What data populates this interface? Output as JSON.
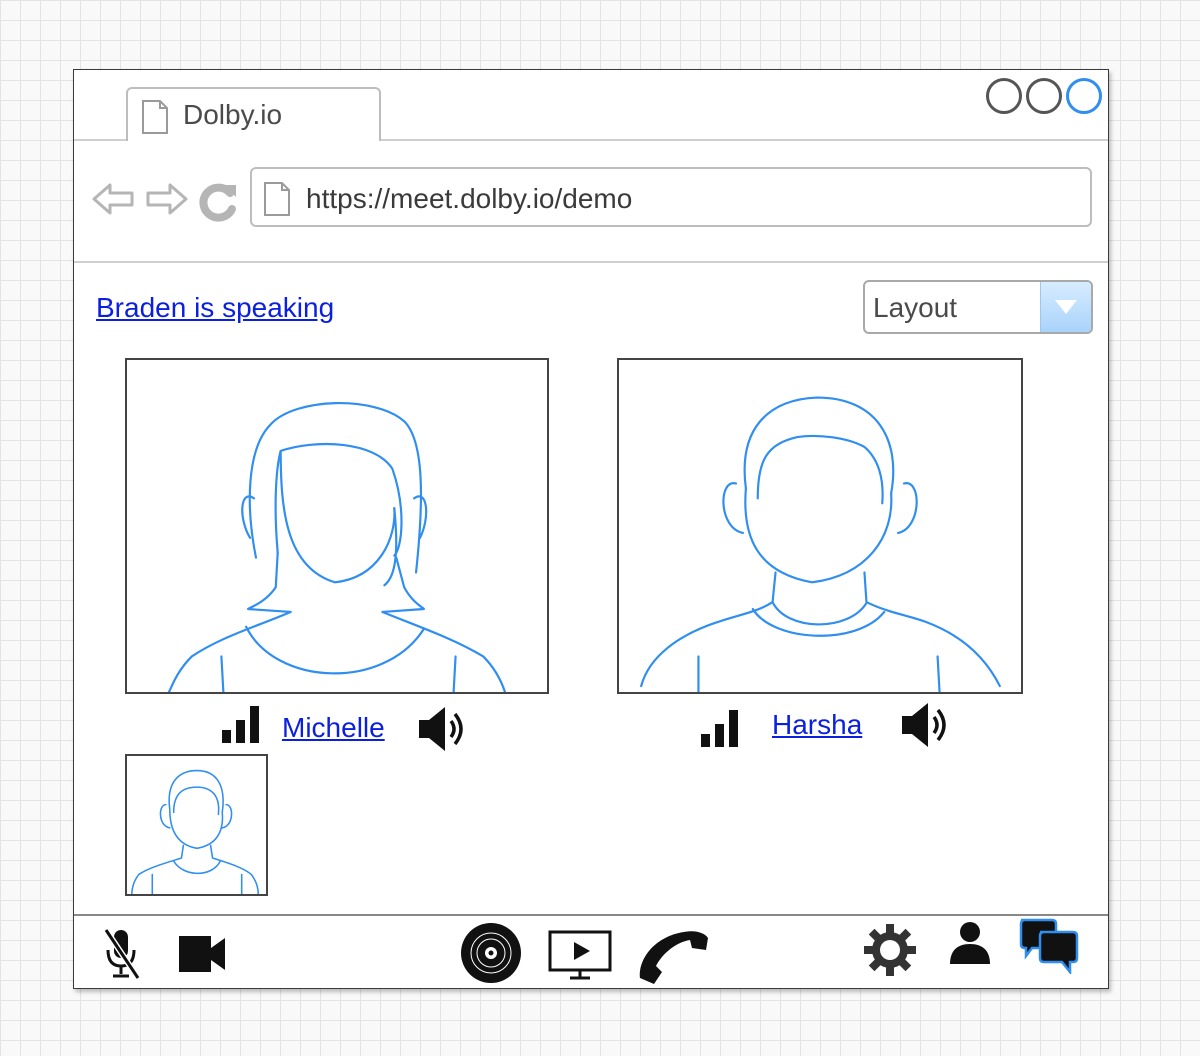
{
  "browser": {
    "tab_title": "Dolby.io",
    "url": "https://meet.dolby.io/demo",
    "icons": {
      "page": "page-icon",
      "back": "back-arrow-icon",
      "forward": "forward-arrow-icon",
      "reload": "reload-icon"
    },
    "window_controls": [
      "minimize-icon",
      "maximize-icon",
      "close-icon"
    ]
  },
  "conference": {
    "speaking_status": "Braden is speaking",
    "layout_select": {
      "selected": "Layout"
    },
    "participants": [
      {
        "name": "Michelle",
        "signal_icon": "signal-bars-icon",
        "audio_icon": "speaker-icon"
      },
      {
        "name": "Harsha",
        "signal_icon": "signal-bars-icon",
        "audio_icon": "speaker-icon"
      }
    ],
    "self_view": {
      "avatar_icon": "person-avatar-icon"
    }
  },
  "toolbar": {
    "left": [
      "mic-muted-icon",
      "video-camera-icon"
    ],
    "center": [
      "record-disc-icon",
      "screen-share-icon",
      "hang-up-phone-icon"
    ],
    "right": [
      "settings-gear-icon",
      "person-icon",
      "chat-icon"
    ]
  },
  "colors": {
    "sketch_blue": "#2f8ef0",
    "link_blue": "#0b1fe0",
    "accent_border": "#2f8ef0"
  }
}
